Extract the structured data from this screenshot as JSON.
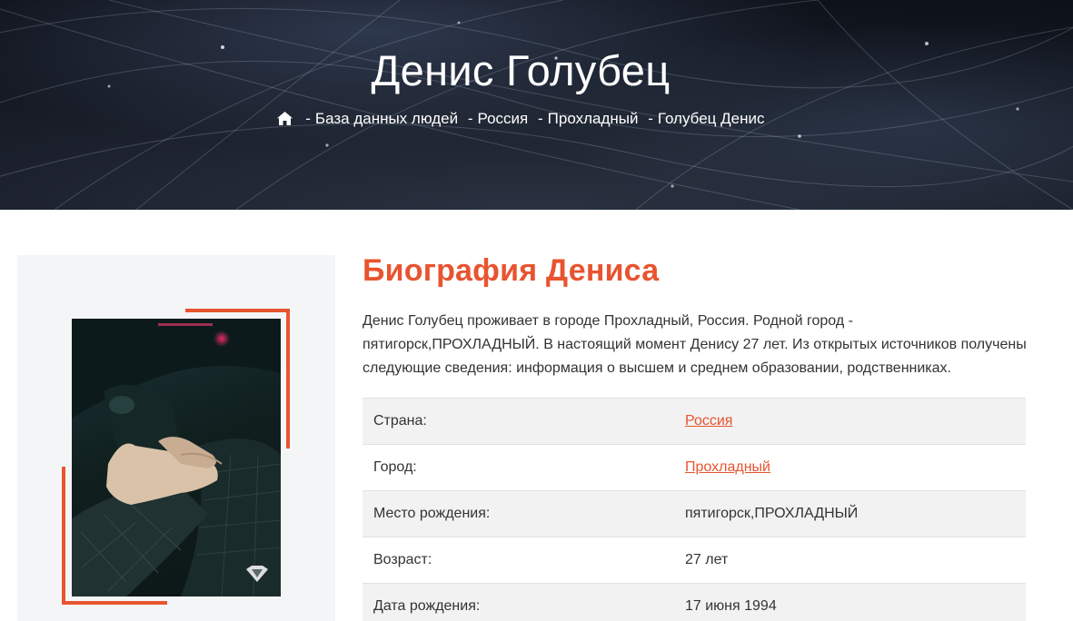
{
  "hero": {
    "title": "Денис Голубец",
    "breadcrumb": {
      "home_icon": "home-icon",
      "separator": "-",
      "items": [
        {
          "label": "База данных людей"
        },
        {
          "label": "Россия"
        },
        {
          "label": "Прохладный"
        },
        {
          "label": "Голубец Денис"
        }
      ]
    }
  },
  "bio": {
    "heading": "Биография Дениса",
    "text": "Денис Голубец проживает в городе Прохладный, Россия. Родной город - пятигорск,ПРОХЛАДНЫЙ. В настоящий момент Денису 27 лет. Из открытых источников получены следующие сведения: информация о высшем и среднем образовании, родственниках."
  },
  "info_rows": [
    {
      "label": "Страна:",
      "value": "Россия",
      "link": true
    },
    {
      "label": "Город:",
      "value": "Прохладный",
      "link": true
    },
    {
      "label": "Место рождения:",
      "value": "пятигорск,ПРОХЛАДНЫЙ",
      "link": false
    },
    {
      "label": "Возраст:",
      "value": "27 лет",
      "link": false
    },
    {
      "label": "Дата рождения:",
      "value": "17 июня 1994",
      "link": false
    }
  ],
  "colors": {
    "accent": "#e8542f",
    "panel_bg": "#f4f5f7",
    "row_alt_bg": "#f2f2f2"
  }
}
